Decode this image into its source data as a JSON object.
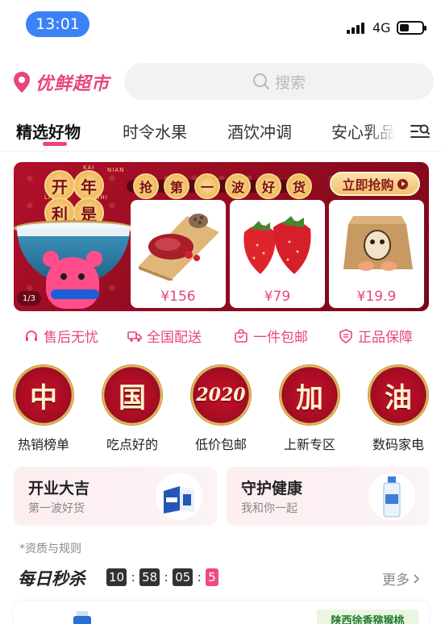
{
  "status_bar": {
    "time": "13:01",
    "network": "4G"
  },
  "header": {
    "brand": "优鲜超市",
    "search_placeholder": "搜索"
  },
  "tabs": [
    "精选好物",
    "时令水果",
    "酒饮冲调",
    "安心乳品"
  ],
  "banner": {
    "seal_chars": [
      "开",
      "年",
      "利",
      "是"
    ],
    "seal_latin": [
      "KAI",
      "NIAN",
      "LI",
      "SHI"
    ],
    "slogan_chars": [
      "抢",
      "第",
      "一",
      "波",
      "好",
      "货"
    ],
    "cta": "立即抢购",
    "page_indicator": "1/3",
    "products": [
      {
        "name": "牛肉",
        "price": "¥156"
      },
      {
        "name": "草莓",
        "price": "¥79"
      },
      {
        "name": "礼盒",
        "price": "¥19.9"
      }
    ]
  },
  "services": [
    "售后无忧",
    "全国配送",
    "一件包邮",
    "正品保障"
  ],
  "categories": [
    {
      "medal": "中",
      "label": "热销榜单"
    },
    {
      "medal": "国",
      "label": "吃点好的"
    },
    {
      "medal": "2020",
      "label": "低价包邮"
    },
    {
      "medal": "加",
      "label": "上新专区"
    },
    {
      "medal": "油",
      "label": "数码家电"
    }
  ],
  "promos": [
    {
      "title": "开业大吉",
      "subtitle": "第一波好货"
    },
    {
      "title": "守护健康",
      "subtitle": "我和你一起"
    }
  ],
  "rules_link": "*资质与规则",
  "flash_sale": {
    "title": "每日秒杀",
    "countdown": {
      "hours": "10",
      "minutes": "58",
      "seconds": "05",
      "tenths": "5"
    },
    "more": "更多",
    "item_tag": "陕西徐香猕猴桃"
  },
  "colors": {
    "brand": "#e8467c",
    "banner_red": "#b2102a",
    "gold": "#f2c16e",
    "time_pill": "#3b82f6"
  }
}
